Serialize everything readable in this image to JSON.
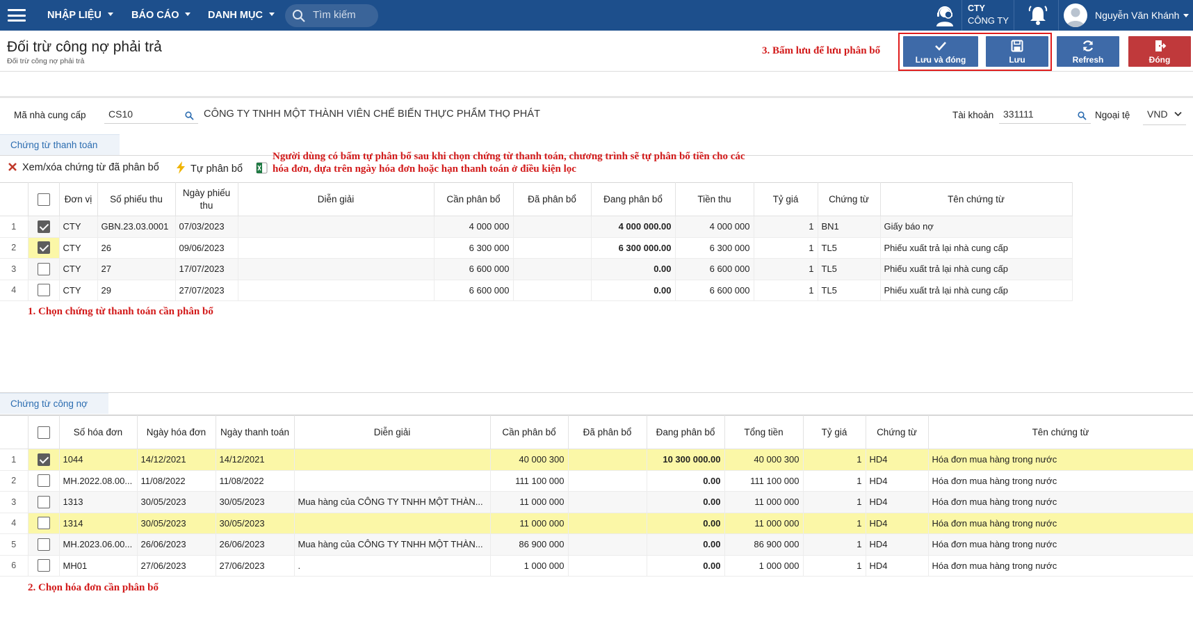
{
  "nav": {
    "menus": [
      "NHẬP LIỆU",
      "BÁO CÁO",
      "DANH MỤC"
    ],
    "search_placeholder": "Tìm kiếm",
    "company_short": "CTY",
    "company_label": "CÔNG TY",
    "user_name": "Nguyễn Văn Khánh"
  },
  "header": {
    "title": "Đối trừ công nợ phải trả",
    "subtitle": "Đối trừ công nợ phải trả",
    "note_save": "3. Bấm lưu để lưu phân bổ",
    "buttons": {
      "save_close": "Lưu và đóng",
      "save": "Lưu",
      "refresh": "Refresh",
      "close": "Đóng"
    },
    "colors": {
      "primary": "#1d4f8c",
      "button_blue": "#3e6aa8",
      "button_red": "#c0393b",
      "note_red": "#d21a1a",
      "highlight_row": "#fbf7a7"
    }
  },
  "filter": {
    "supplier_label": "Mã nhà cung cấp",
    "supplier_code": "CS10",
    "supplier_name": "CÔNG TY TNHH MỘT THÀNH VIÊN CHẾ BIẾN THỰC PHẨM THỌ PHÁT",
    "account_label": "Tài khoản",
    "account_value": "331111",
    "currency_label": "Ngoại tệ",
    "currency_value": "VND"
  },
  "payments": {
    "tab": "Chứng từ thanh toán",
    "toolbar": {
      "view_delete": "Xem/xóa chứng từ đã phân bổ",
      "auto_allocate": "Tự phân bổ"
    },
    "note_auto": "Người dùng có bấm tự phân bổ sau khi chọn chứng từ thanh toán, chương trình sẽ tự phân bổ tiền cho các hóa đơn, dựa trên ngày hóa đơn hoặc hạn thanh toán ở điều kiện lọc",
    "note_select": "1. Chọn chứng từ thanh toán cần phân bổ",
    "columns": [
      "Đơn vị",
      "Số phiếu thu",
      "Ngày phiếu thu",
      "Diễn giải",
      "Cần phân bổ",
      "Đã phân bổ",
      "Đang phân bổ",
      "Tiền thu",
      "Tỷ giá",
      "Chứng từ",
      "Tên chứng từ"
    ],
    "rows": [
      {
        "no": "1",
        "checked": true,
        "unit": "CTY",
        "code": "GBN.23.03.0001",
        "date": "07/03/2023",
        "desc": "",
        "need": "4 000 000",
        "done": "",
        "doing": "4 000 000.00",
        "amount": "4 000 000",
        "rate": "1",
        "voucher": "BN1",
        "vname": "Giấy báo nợ"
      },
      {
        "no": "2",
        "checked": true,
        "unit": "CTY",
        "code": "26",
        "date": "09/06/2023",
        "desc": "",
        "need": "6 300 000",
        "done": "",
        "doing": "6 300 000.00",
        "amount": "6 300 000",
        "rate": "1",
        "voucher": "TL5",
        "vname": "Phiếu xuất trả lại nhà cung cấp"
      },
      {
        "no": "3",
        "checked": false,
        "unit": "CTY",
        "code": "27",
        "date": "17/07/2023",
        "desc": "",
        "need": "6 600 000",
        "done": "",
        "doing": "0.00",
        "amount": "6 600 000",
        "rate": "1",
        "voucher": "TL5",
        "vname": "Phiếu xuất trả lại nhà cung cấp"
      },
      {
        "no": "4",
        "checked": false,
        "unit": "CTY",
        "code": "29",
        "date": "27/07/2023",
        "desc": "",
        "need": "6 600 000",
        "done": "",
        "doing": "0.00",
        "amount": "6 600 000",
        "rate": "1",
        "voucher": "TL5",
        "vname": "Phiếu xuất trả lại nhà cung cấp"
      }
    ]
  },
  "invoices": {
    "tab": "Chứng từ công nợ",
    "note_select": "2. Chọn hóa đơn cần phân bổ",
    "columns": [
      "Số hóa đơn",
      "Ngày hóa đơn",
      "Ngày thanh toán",
      "Diễn giải",
      "Cần phân bổ",
      "Đã phân bổ",
      "Đang phân bổ",
      "Tổng tiền",
      "Tỷ giá",
      "Chứng từ",
      "Tên chứng từ"
    ],
    "rows": [
      {
        "no": "1",
        "checked": true,
        "highlight": true,
        "inv": "1044",
        "date": "14/12/2021",
        "paydate": "14/12/2021",
        "desc": "",
        "need": "40 000 300",
        "done": "",
        "doing": "10 300 000.00",
        "total": "40 000 300",
        "rate": "1",
        "voucher": "HD4",
        "vname": "Hóa đơn mua hàng trong nước"
      },
      {
        "no": "2",
        "checked": false,
        "highlight": false,
        "inv": "MH.2022.08.00...",
        "date": "11/08/2022",
        "paydate": "11/08/2022",
        "desc": "",
        "need": "111 100 000",
        "done": "",
        "doing": "0.00",
        "total": "111 100 000",
        "rate": "1",
        "voucher": "HD4",
        "vname": "Hóa đơn mua hàng trong nước"
      },
      {
        "no": "3",
        "checked": false,
        "highlight": false,
        "inv": "1313",
        "date": "30/05/2023",
        "paydate": "30/05/2023",
        "desc": "Mua hàng của CÔNG TY TNHH MỘT THÀN...",
        "need": "11 000 000",
        "done": "",
        "doing": "0.00",
        "total": "11 000 000",
        "rate": "1",
        "voucher": "HD4",
        "vname": "Hóa đơn mua hàng trong nước"
      },
      {
        "no": "4",
        "checked": false,
        "highlight": true,
        "inv": "1314",
        "date": "30/05/2023",
        "paydate": "30/05/2023",
        "desc": "",
        "need": "11 000 000",
        "done": "",
        "doing": "0.00",
        "total": "11 000 000",
        "rate": "1",
        "voucher": "HD4",
        "vname": "Hóa đơn mua hàng trong nước"
      },
      {
        "no": "5",
        "checked": false,
        "highlight": false,
        "inv": "MH.2023.06.00...",
        "date": "26/06/2023",
        "paydate": "26/06/2023",
        "desc": "Mua hàng của CÔNG TY TNHH MỘT THÀN...",
        "need": "86 900 000",
        "done": "",
        "doing": "0.00",
        "total": "86 900 000",
        "rate": "1",
        "voucher": "HD4",
        "vname": "Hóa đơn mua hàng trong nước"
      },
      {
        "no": "6",
        "checked": false,
        "highlight": false,
        "inv": "MH01",
        "date": "27/06/2023",
        "paydate": "27/06/2023",
        "desc": ".",
        "need": "1 000 000",
        "done": "",
        "doing": "0.00",
        "total": "1 000 000",
        "rate": "1",
        "voucher": "HD4",
        "vname": "Hóa đơn mua hàng trong nước"
      }
    ]
  }
}
